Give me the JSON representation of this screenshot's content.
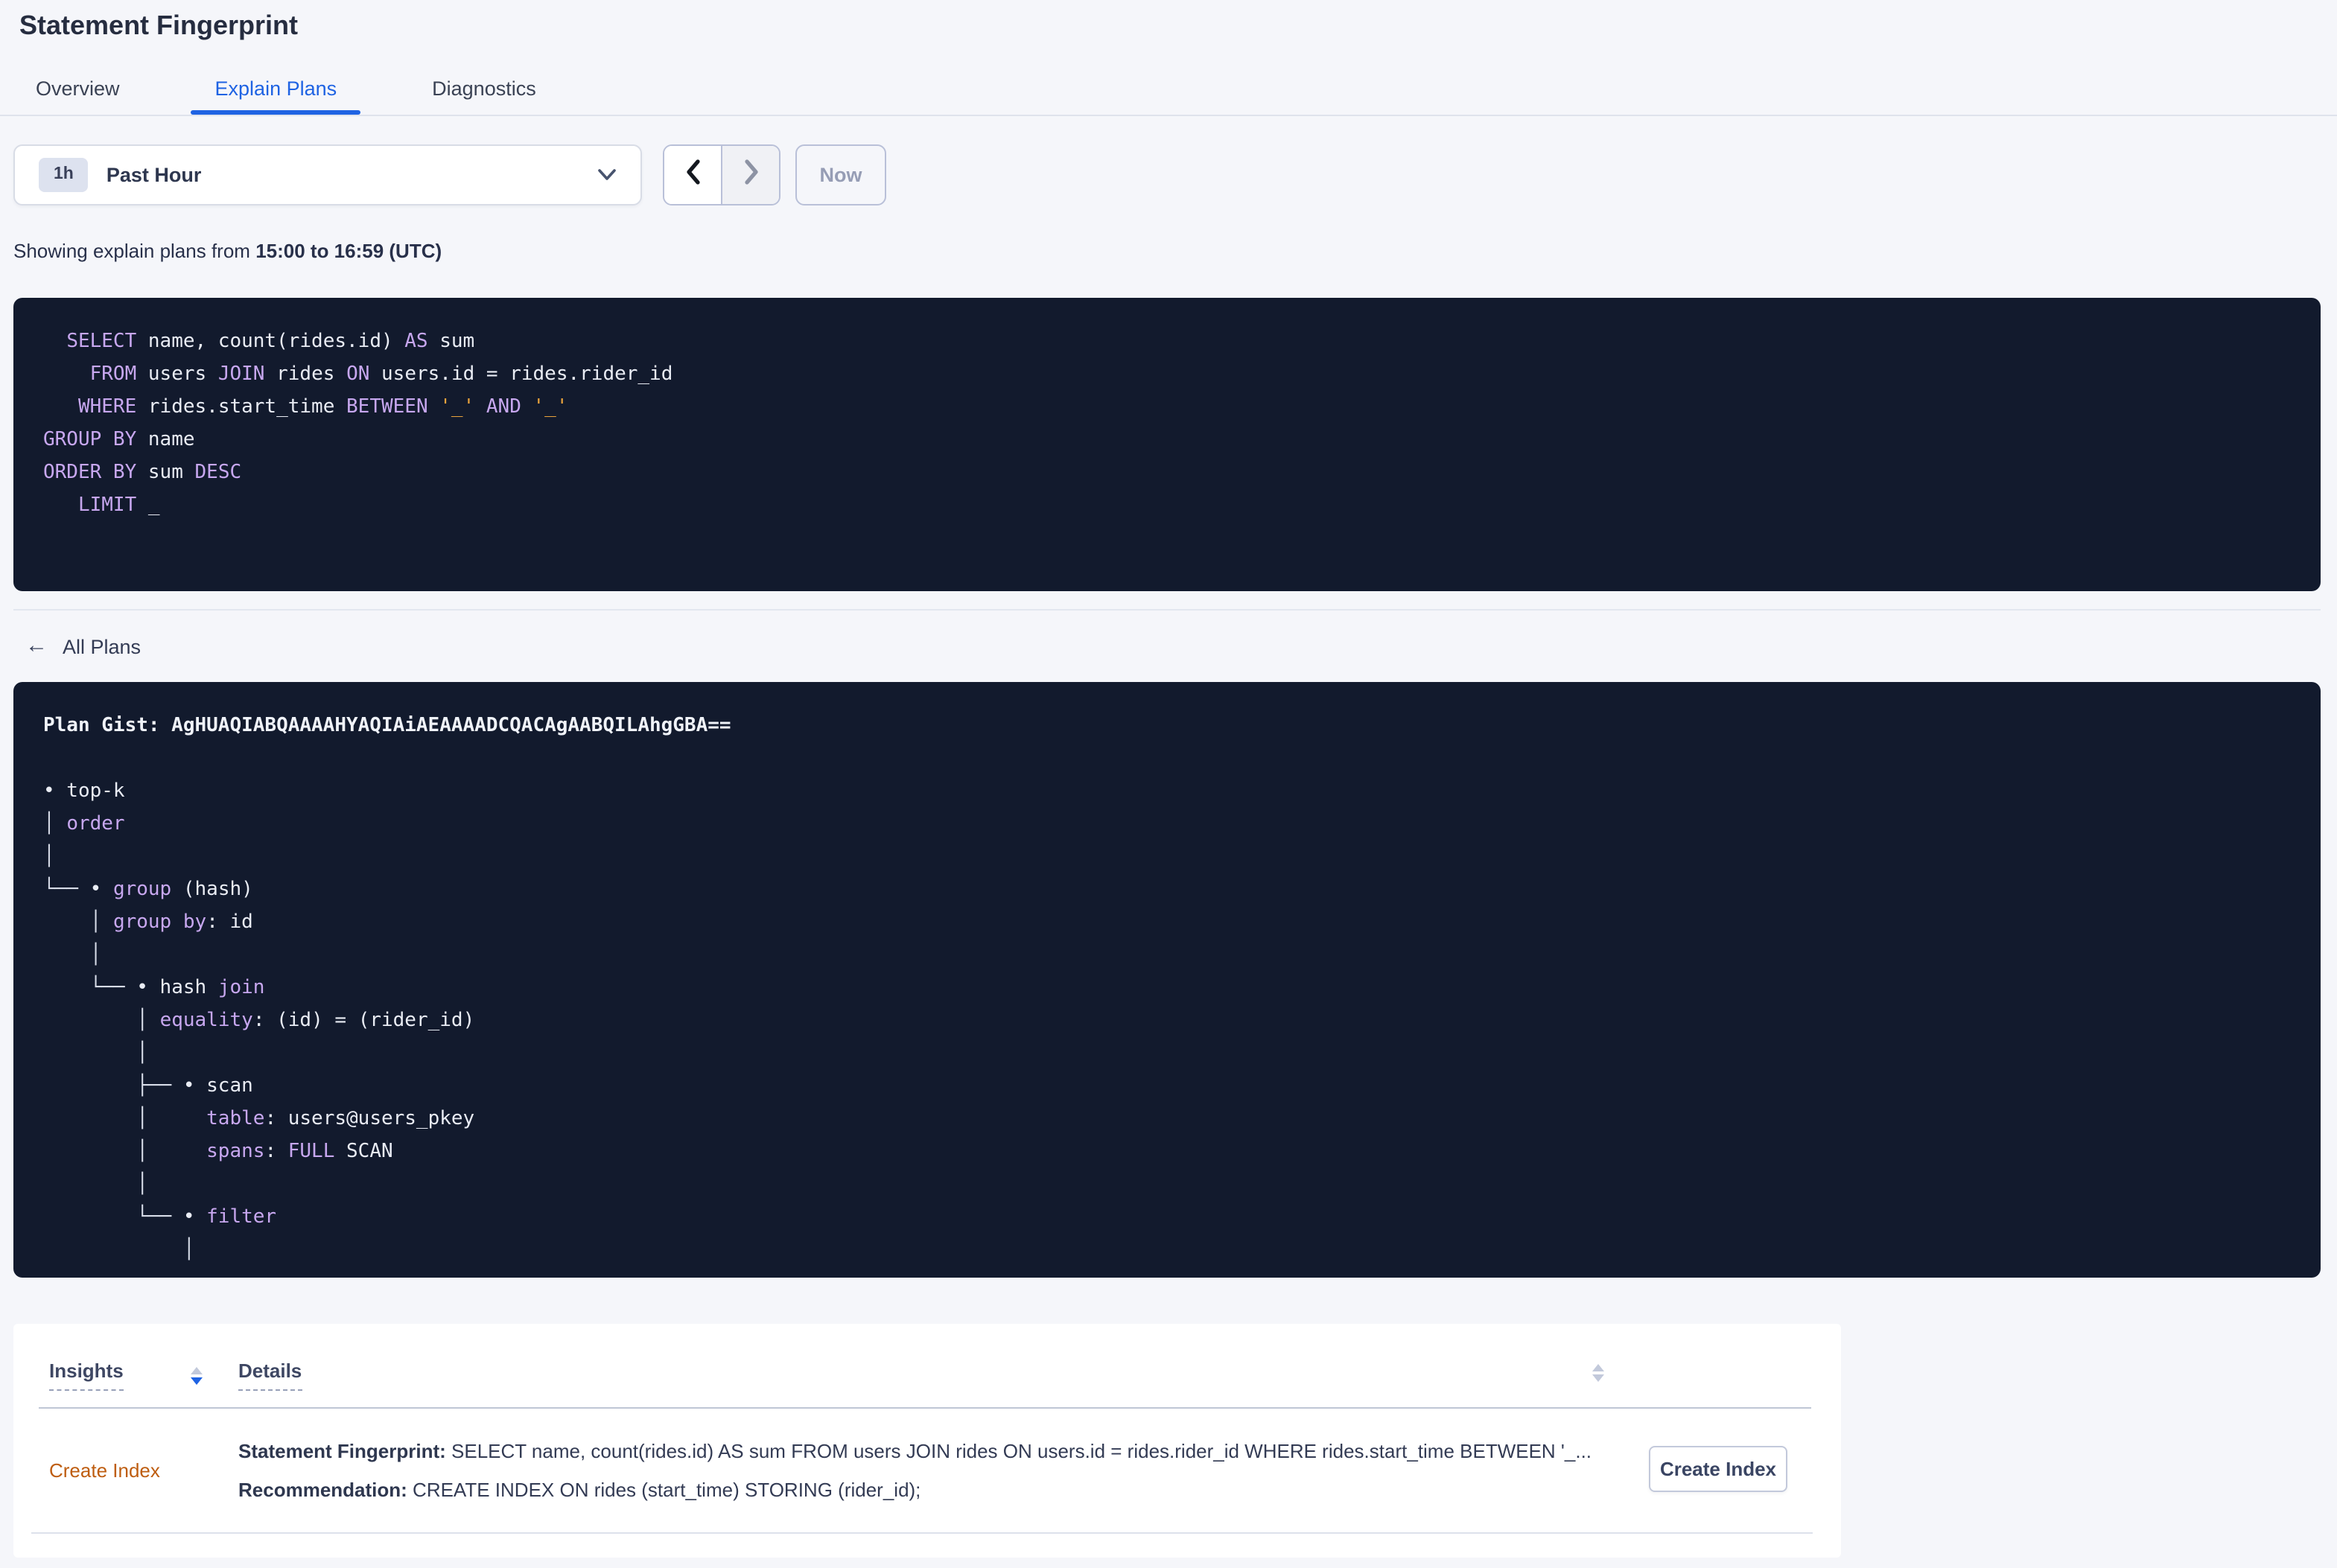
{
  "page": {
    "title": "Statement Fingerprint"
  },
  "tabs": [
    {
      "label": "Overview",
      "active": false
    },
    {
      "label": "Explain Plans",
      "active": true
    },
    {
      "label": "Diagnostics",
      "active": false
    }
  ],
  "time_controls": {
    "interval_badge": "1h",
    "selected_range": "Past Hour",
    "now_label": "Now",
    "icons": {
      "dropdown": "chevron-down-icon",
      "prev": "chevron-left-icon",
      "next": "chevron-right-icon"
    }
  },
  "subtitle": {
    "prefix": "Showing explain plans from ",
    "bold_range": "15:00 to 16:59 (UTC)"
  },
  "sql": {
    "lines": [
      [
        [
          "p",
          "  "
        ],
        [
          "k",
          "SELECT"
        ],
        [
          "p",
          " name, count(rides.id) "
        ],
        [
          "k",
          "AS"
        ],
        [
          "p",
          " sum"
        ]
      ],
      [
        [
          "p",
          "    "
        ],
        [
          "k",
          "FROM"
        ],
        [
          "p",
          " users "
        ],
        [
          "k",
          "JOIN"
        ],
        [
          "p",
          " rides "
        ],
        [
          "k",
          "ON"
        ],
        [
          "p",
          " users.id = rides.rider_id"
        ]
      ],
      [
        [
          "p",
          "   "
        ],
        [
          "k",
          "WHERE"
        ],
        [
          "p",
          " rides.start_time "
        ],
        [
          "k",
          "BETWEEN"
        ],
        [
          "p",
          " "
        ],
        [
          "o",
          "'_'"
        ],
        [
          "p",
          " "
        ],
        [
          "k",
          "AND"
        ],
        [
          "p",
          " "
        ],
        [
          "o",
          "'_'"
        ]
      ],
      [
        [
          "k",
          "GROUP BY"
        ],
        [
          "p",
          " name"
        ]
      ],
      [
        [
          "k",
          "ORDER BY"
        ],
        [
          "p",
          " sum "
        ],
        [
          "k",
          "DESC"
        ]
      ],
      [
        [
          "p",
          "   "
        ],
        [
          "k",
          "LIMIT"
        ],
        [
          "p",
          " _"
        ]
      ]
    ]
  },
  "back_link": {
    "label": "All Plans",
    "icon": "arrow-left-icon",
    "glyph": "←"
  },
  "plan": {
    "lines": [
      [
        [
          "g",
          "Plan Gist: AgHUAQIABQAAAAHYAQIAiAEAAAADCQACAgAABQILAhgGBA=="
        ]
      ],
      [],
      [
        [
          "p",
          "• top-k"
        ]
      ],
      [
        [
          "t",
          "│ "
        ],
        [
          "k",
          "order"
        ]
      ],
      [
        [
          "t",
          "│"
        ]
      ],
      [
        [
          "t",
          "└── "
        ],
        [
          "p",
          "• "
        ],
        [
          "k",
          "group"
        ],
        [
          "p",
          " (hash)"
        ]
      ],
      [
        [
          "t",
          "    │ "
        ],
        [
          "k",
          "group by"
        ],
        [
          "p",
          ": id"
        ]
      ],
      [
        [
          "t",
          "    │"
        ]
      ],
      [
        [
          "t",
          "    └── "
        ],
        [
          "p",
          "• hash "
        ],
        [
          "k",
          "join"
        ]
      ],
      [
        [
          "t",
          "        │ "
        ],
        [
          "k",
          "equality"
        ],
        [
          "p",
          ": (id) = (rider_id)"
        ]
      ],
      [
        [
          "t",
          "        │"
        ]
      ],
      [
        [
          "t",
          "        ├── "
        ],
        [
          "p",
          "• scan"
        ]
      ],
      [
        [
          "t",
          "        │     "
        ],
        [
          "k",
          "table"
        ],
        [
          "p",
          ": users@users_pkey"
        ]
      ],
      [
        [
          "t",
          "        │     "
        ],
        [
          "k",
          "spans"
        ],
        [
          "p",
          ": "
        ],
        [
          "k",
          "FULL"
        ],
        [
          "p",
          " SCAN"
        ]
      ],
      [
        [
          "t",
          "        │"
        ]
      ],
      [
        [
          "t",
          "        └── "
        ],
        [
          "p",
          "• "
        ],
        [
          "k",
          "filter"
        ]
      ],
      [
        [
          "t",
          "            │"
        ]
      ]
    ]
  },
  "insights_table": {
    "columns": [
      {
        "label": "Insights",
        "sorted": "desc"
      },
      {
        "label": "Details",
        "sorted": null
      }
    ],
    "sort_icons": {
      "asc": "triangle-up-icon",
      "desc": "triangle-down-icon"
    },
    "rows": [
      {
        "insight": "Create Index",
        "details_lines": [
          [
            [
              "b",
              "Statement Fingerprint:"
            ],
            [
              "n",
              " SELECT name, count(rides.id) AS sum FROM users JOIN rides ON users.id = rides.rider_id WHERE rides.start_time BETWEEN '_..."
            ]
          ],
          [
            [
              "b",
              "Recommendation:"
            ],
            [
              "n",
              " CREATE INDEX ON rides (start_time) STORING (rider_id);"
            ]
          ]
        ],
        "action_label": "Create Index"
      }
    ]
  },
  "colors": {
    "accent_blue": "#1F63E3",
    "code_keyword_purple": "#C7A7EF",
    "code_plain": "#E9ECF4",
    "code_literal_orange": "#E9A23C",
    "code_background": "#121A2D",
    "insight_link_orange": "#BE5D10",
    "page_background": "#F5F6FA"
  }
}
